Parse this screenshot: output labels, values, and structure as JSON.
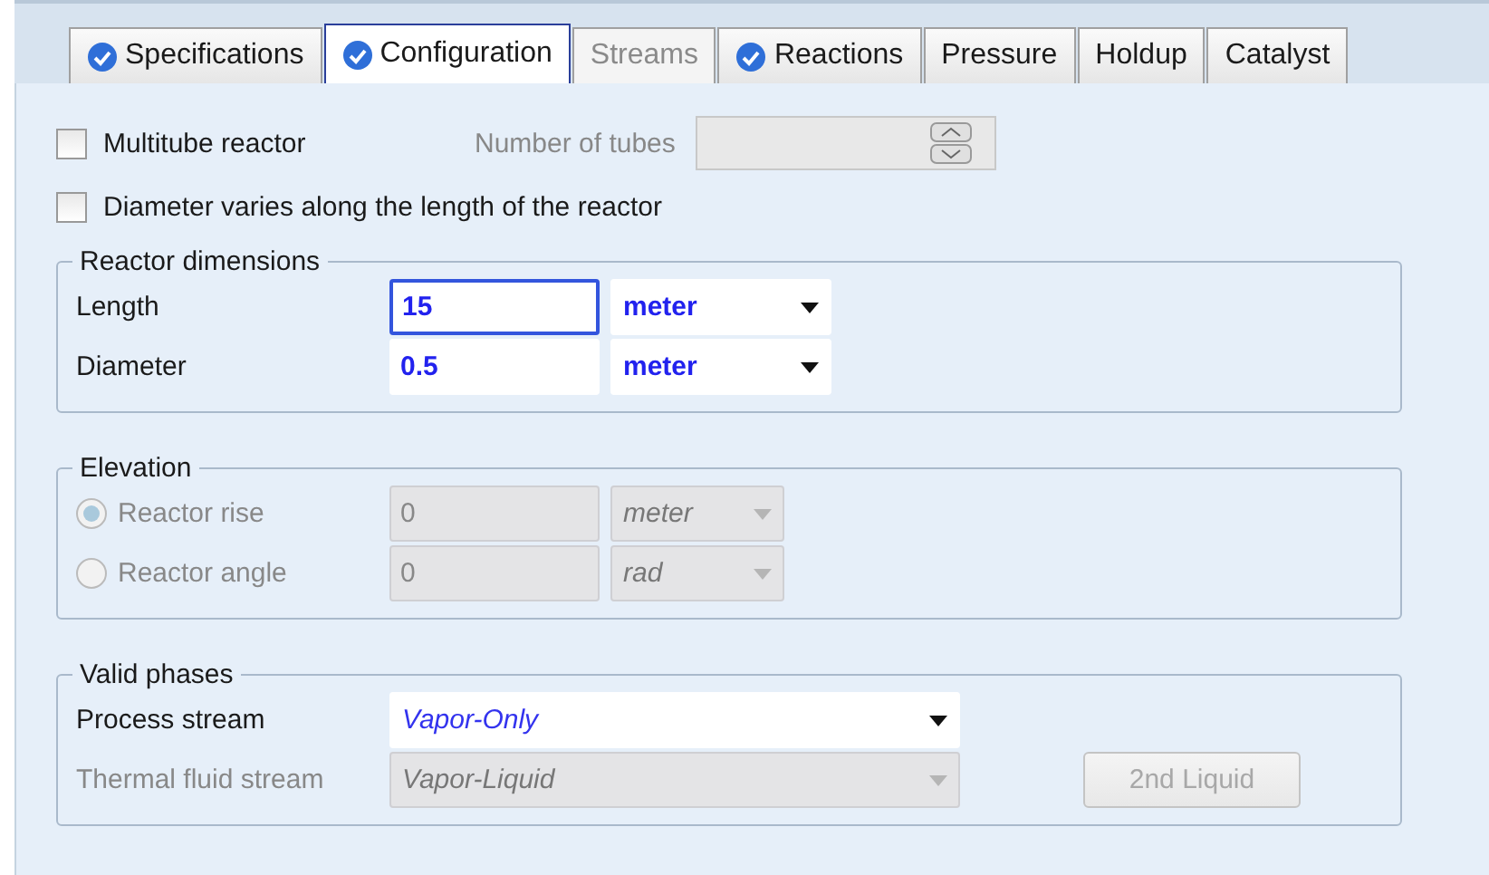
{
  "tabs": [
    {
      "label": "Specifications",
      "selected": false,
      "disabled": false,
      "complete": true
    },
    {
      "label": "Configuration",
      "selected": true,
      "disabled": false,
      "complete": true
    },
    {
      "label": "Streams",
      "selected": false,
      "disabled": true,
      "complete": false
    },
    {
      "label": "Reactions",
      "selected": false,
      "disabled": false,
      "complete": true
    },
    {
      "label": "Pressure",
      "selected": false,
      "disabled": false,
      "complete": false
    },
    {
      "label": "Holdup",
      "selected": false,
      "disabled": false,
      "complete": false
    },
    {
      "label": "Catalyst",
      "selected": false,
      "disabled": false,
      "complete": false
    }
  ],
  "multitube": {
    "label": "Multitube reactor",
    "checked": false,
    "tubes_label": "Number of tubes",
    "tubes_disabled": true
  },
  "diameter_varies": {
    "label": "Diameter varies along the length of the reactor",
    "checked": false
  },
  "dimensions": {
    "title": "Reactor dimensions",
    "rows": [
      {
        "label": "Length",
        "value": "15",
        "unit": "meter",
        "focused": true
      },
      {
        "label": "Diameter",
        "value": "0.5",
        "unit": "meter",
        "focused": false
      }
    ]
  },
  "elevation": {
    "title": "Elevation",
    "disabled": true,
    "rows": [
      {
        "label": "Reactor rise",
        "value": "0",
        "unit": "meter",
        "selected": true
      },
      {
        "label": "Reactor angle",
        "value": "0",
        "unit": "rad",
        "selected": false
      }
    ]
  },
  "valid_phases": {
    "title": "Valid phases",
    "rows": [
      {
        "label": "Process stream",
        "value": "Vapor-Only",
        "disabled": false
      },
      {
        "label": "Thermal fluid stream",
        "value": "Vapor-Liquid",
        "disabled": true
      }
    ],
    "button": {
      "label": "2nd Liquid",
      "disabled": true
    }
  }
}
